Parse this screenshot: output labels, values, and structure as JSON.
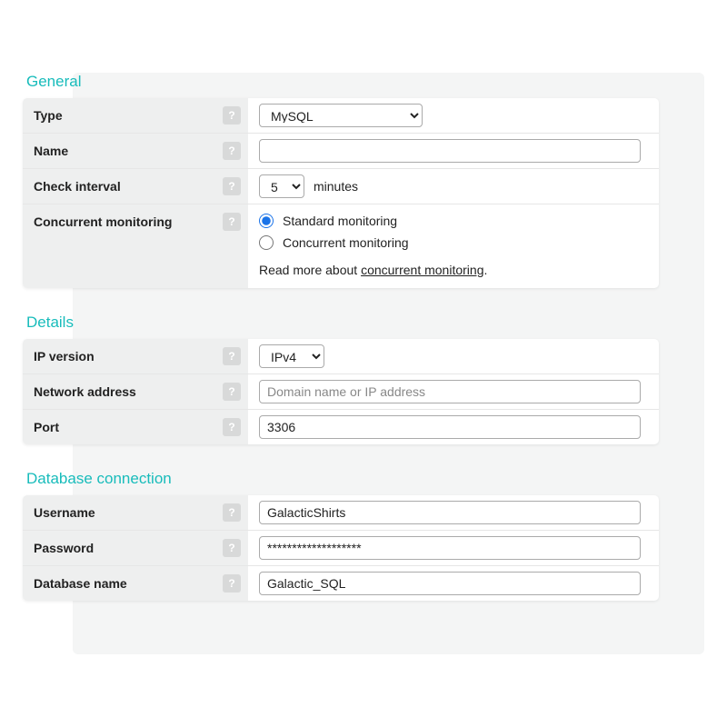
{
  "general": {
    "title": "General",
    "type_label": "Type",
    "type_value": "MySQL",
    "name_label": "Name",
    "name_value": "",
    "interval_label": "Check interval",
    "interval_value": "5",
    "interval_unit": "minutes",
    "concurrent_label": "Concurrent monitoring",
    "concurrent_option_std": "Standard monitoring",
    "concurrent_option_conc": "Concurrent monitoring",
    "readmore_prefix": "Read more about ",
    "readmore_link": "concurrent monitoring",
    "readmore_suffix": "."
  },
  "details": {
    "title": "Details",
    "ipver_label": "IP version",
    "ipver_value": "IPv4",
    "addr_label": "Network address",
    "addr_placeholder": "Domain name or IP address",
    "addr_value": "",
    "port_label": "Port",
    "port_value": "3306"
  },
  "db": {
    "title": "Database connection",
    "user_label": "Username",
    "user_value": "GalacticShirts",
    "pass_label": "Password",
    "pass_value": "*******************",
    "dbname_label": "Database name",
    "dbname_value": "Galactic_SQL"
  },
  "help_glyph": "?"
}
